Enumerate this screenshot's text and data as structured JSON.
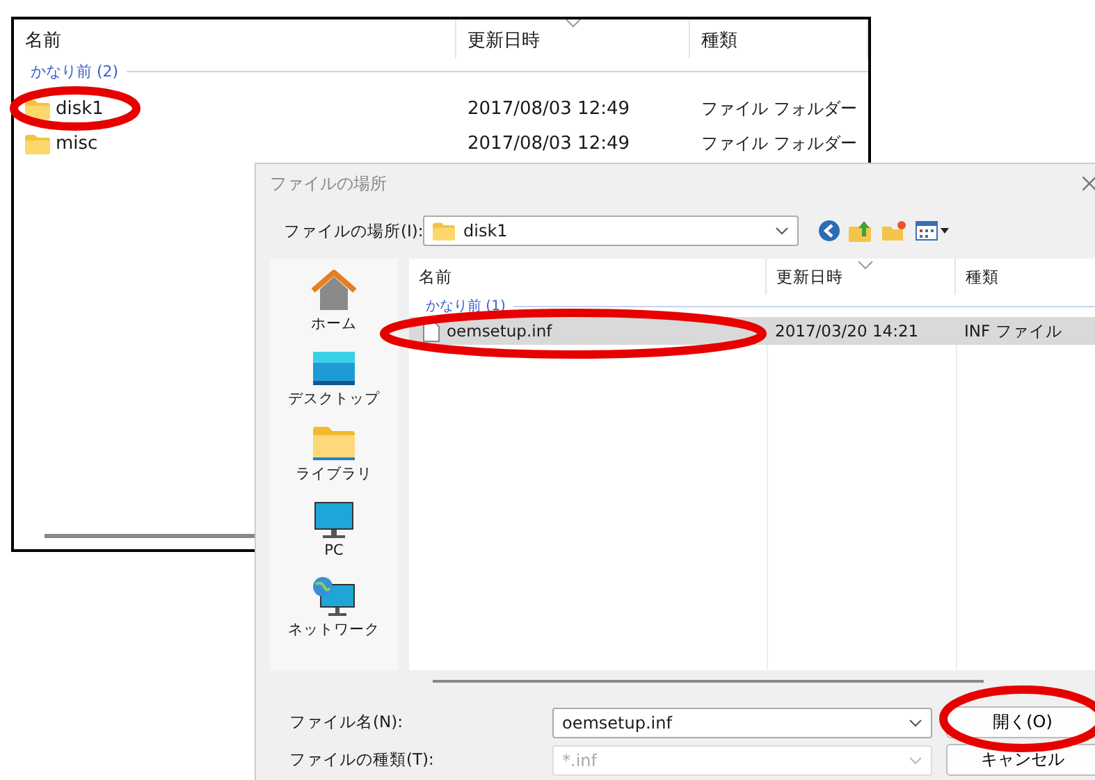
{
  "back_window": {
    "columns": [
      "名前",
      "更新日時",
      "種類"
    ],
    "group": "かなり前 (2)",
    "rows": [
      {
        "name": "disk1",
        "date": "2017/08/03 12:49",
        "type": "ファイル フォルダー"
      },
      {
        "name": "misc",
        "date": "2017/08/03 12:49",
        "type": "ファイル フォルダー"
      }
    ]
  },
  "dialog": {
    "title": "ファイルの場所",
    "location_label": "ファイルの場所(I):",
    "location": "disk1",
    "places": [
      {
        "label": "ホーム",
        "kind": "home"
      },
      {
        "label": "デスクトップ",
        "kind": "desktop"
      },
      {
        "label": "ライブラリ",
        "kind": "library"
      },
      {
        "label": "PC",
        "kind": "pc"
      },
      {
        "label": "ネットワーク",
        "kind": "network"
      }
    ],
    "columns": [
      "名前",
      "更新日時",
      "種類"
    ],
    "group": "かなり前 (1)",
    "files": [
      {
        "name": "oemsetup.inf",
        "date": "2017/03/20 14:21",
        "type": "INF ファイル",
        "selected": true
      }
    ],
    "filename_label": "ファイル名(N):",
    "filename": "oemsetup.inf",
    "filetype_label": "ファイルの種類(T):",
    "filetype": "*.inf",
    "buttons": [
      "開く(O)",
      "キャンセル"
    ]
  }
}
